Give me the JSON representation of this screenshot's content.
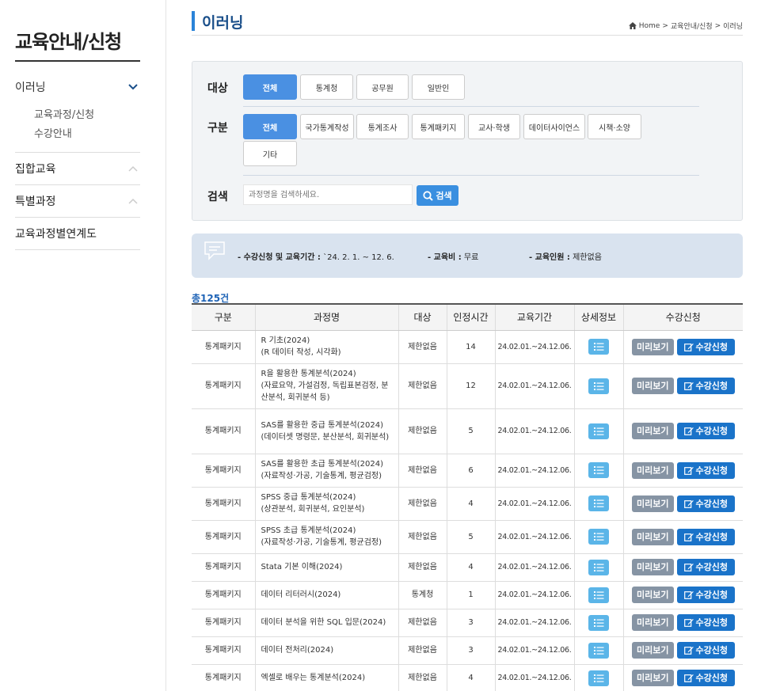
{
  "sidebar": {
    "title": "교육안내/신청",
    "items": [
      {
        "label": "이러닝",
        "sub": [
          "교육과정/신청",
          "수강안내"
        ]
      },
      {
        "label": "집합교육"
      },
      {
        "label": "특별과정"
      },
      {
        "label": "교육과정별연계도"
      }
    ]
  },
  "header": {
    "title": "이러닝",
    "breadcrumb": [
      "Home",
      ">",
      "교육안내/신청",
      ">",
      "이러닝"
    ]
  },
  "filter": {
    "target_label": "대상",
    "target_options": [
      "전체",
      "통계청",
      "공무원",
      "일반인"
    ],
    "category_label": "구분",
    "category_options": [
      "전체",
      "국가통계작성",
      "통계조사",
      "통계패키지",
      "교사·학생",
      "데이터사이언스",
      "시책·소양",
      "기타"
    ],
    "search_label": "검색",
    "search_placeholder": "과정명을 검색하세요.",
    "search_button": "검색"
  },
  "notice": {
    "period_label": "- 수강신청 및 교육기간 :",
    "period_value": "`24. 2. 1. ~ 12. 6.",
    "fee_label": "- 교육비 :",
    "fee_value": "무료",
    "people_label": "- 교육인원 :",
    "people_value": "제한없음"
  },
  "total": "총125건",
  "table": {
    "headers": [
      "구분",
      "과정명",
      "대상",
      "인정시간",
      "교육기간",
      "상세정보",
      "수강신청"
    ],
    "preview_label": "미리보기",
    "apply_label": "수강신청",
    "rows": [
      {
        "cat": "통계패키지",
        "title": "R 기초(2024)\n(R 데이터 작성, 시각화)",
        "target": "제한없음",
        "hours": "14",
        "period": "24.02.01.~24.12.06."
      },
      {
        "cat": "통계패키지",
        "title": "R을 활용한 통계분석(2024)\n(자료요약, 가설검정, 독립표본검정, 분산분석, 회귀분석 등)",
        "target": "제한없음",
        "hours": "12",
        "period": "24.02.01.~24.12.06."
      },
      {
        "cat": "통계패키지",
        "title": "SAS를 활용한 중급 통계분석(2024)\n(데이터셋 명령문, 분산분석, 회귀분석)",
        "target": "제한없음",
        "hours": "5",
        "period": "24.02.01.~24.12.06."
      },
      {
        "cat": "통계패키지",
        "title": "SAS를 활용한 초급 통계분석(2024)\n(자료작성·가공, 기술통계, 평균검정)",
        "target": "제한없음",
        "hours": "6",
        "period": "24.02.01.~24.12.06."
      },
      {
        "cat": "통계패키지",
        "title": "SPSS 중급 통계분석(2024)\n(상관분석, 회귀분석, 요인분석)",
        "target": "제한없음",
        "hours": "4",
        "period": "24.02.01.~24.12.06."
      },
      {
        "cat": "통계패키지",
        "title": "SPSS 초급 통계분석(2024)\n(자료작성·가공, 기술통계, 평균검정)",
        "target": "제한없음",
        "hours": "5",
        "period": "24.02.01.~24.12.06."
      },
      {
        "cat": "통계패키지",
        "title": "Stata 기본 이해(2024)",
        "target": "제한없음",
        "hours": "4",
        "period": "24.02.01.~24.12.06."
      },
      {
        "cat": "통계패키지",
        "title": "데이터 리터러시(2024)",
        "target": "통계청",
        "hours": "1",
        "period": "24.02.01.~24.12.06."
      },
      {
        "cat": "통계패키지",
        "title": "데이터 분석을 위한 SQL 입문(2024)",
        "target": "제한없음",
        "hours": "3",
        "period": "24.02.01.~24.12.06."
      },
      {
        "cat": "통계패키지",
        "title": "데이터 전처리(2024)",
        "target": "제한없음",
        "hours": "3",
        "period": "24.02.01.~24.12.06."
      },
      {
        "cat": "통계패키지",
        "title": "엑셀로 배우는 통계분석(2024)",
        "target": "제한없음",
        "hours": "4",
        "period": "24.02.01.~24.12.06."
      }
    ]
  }
}
